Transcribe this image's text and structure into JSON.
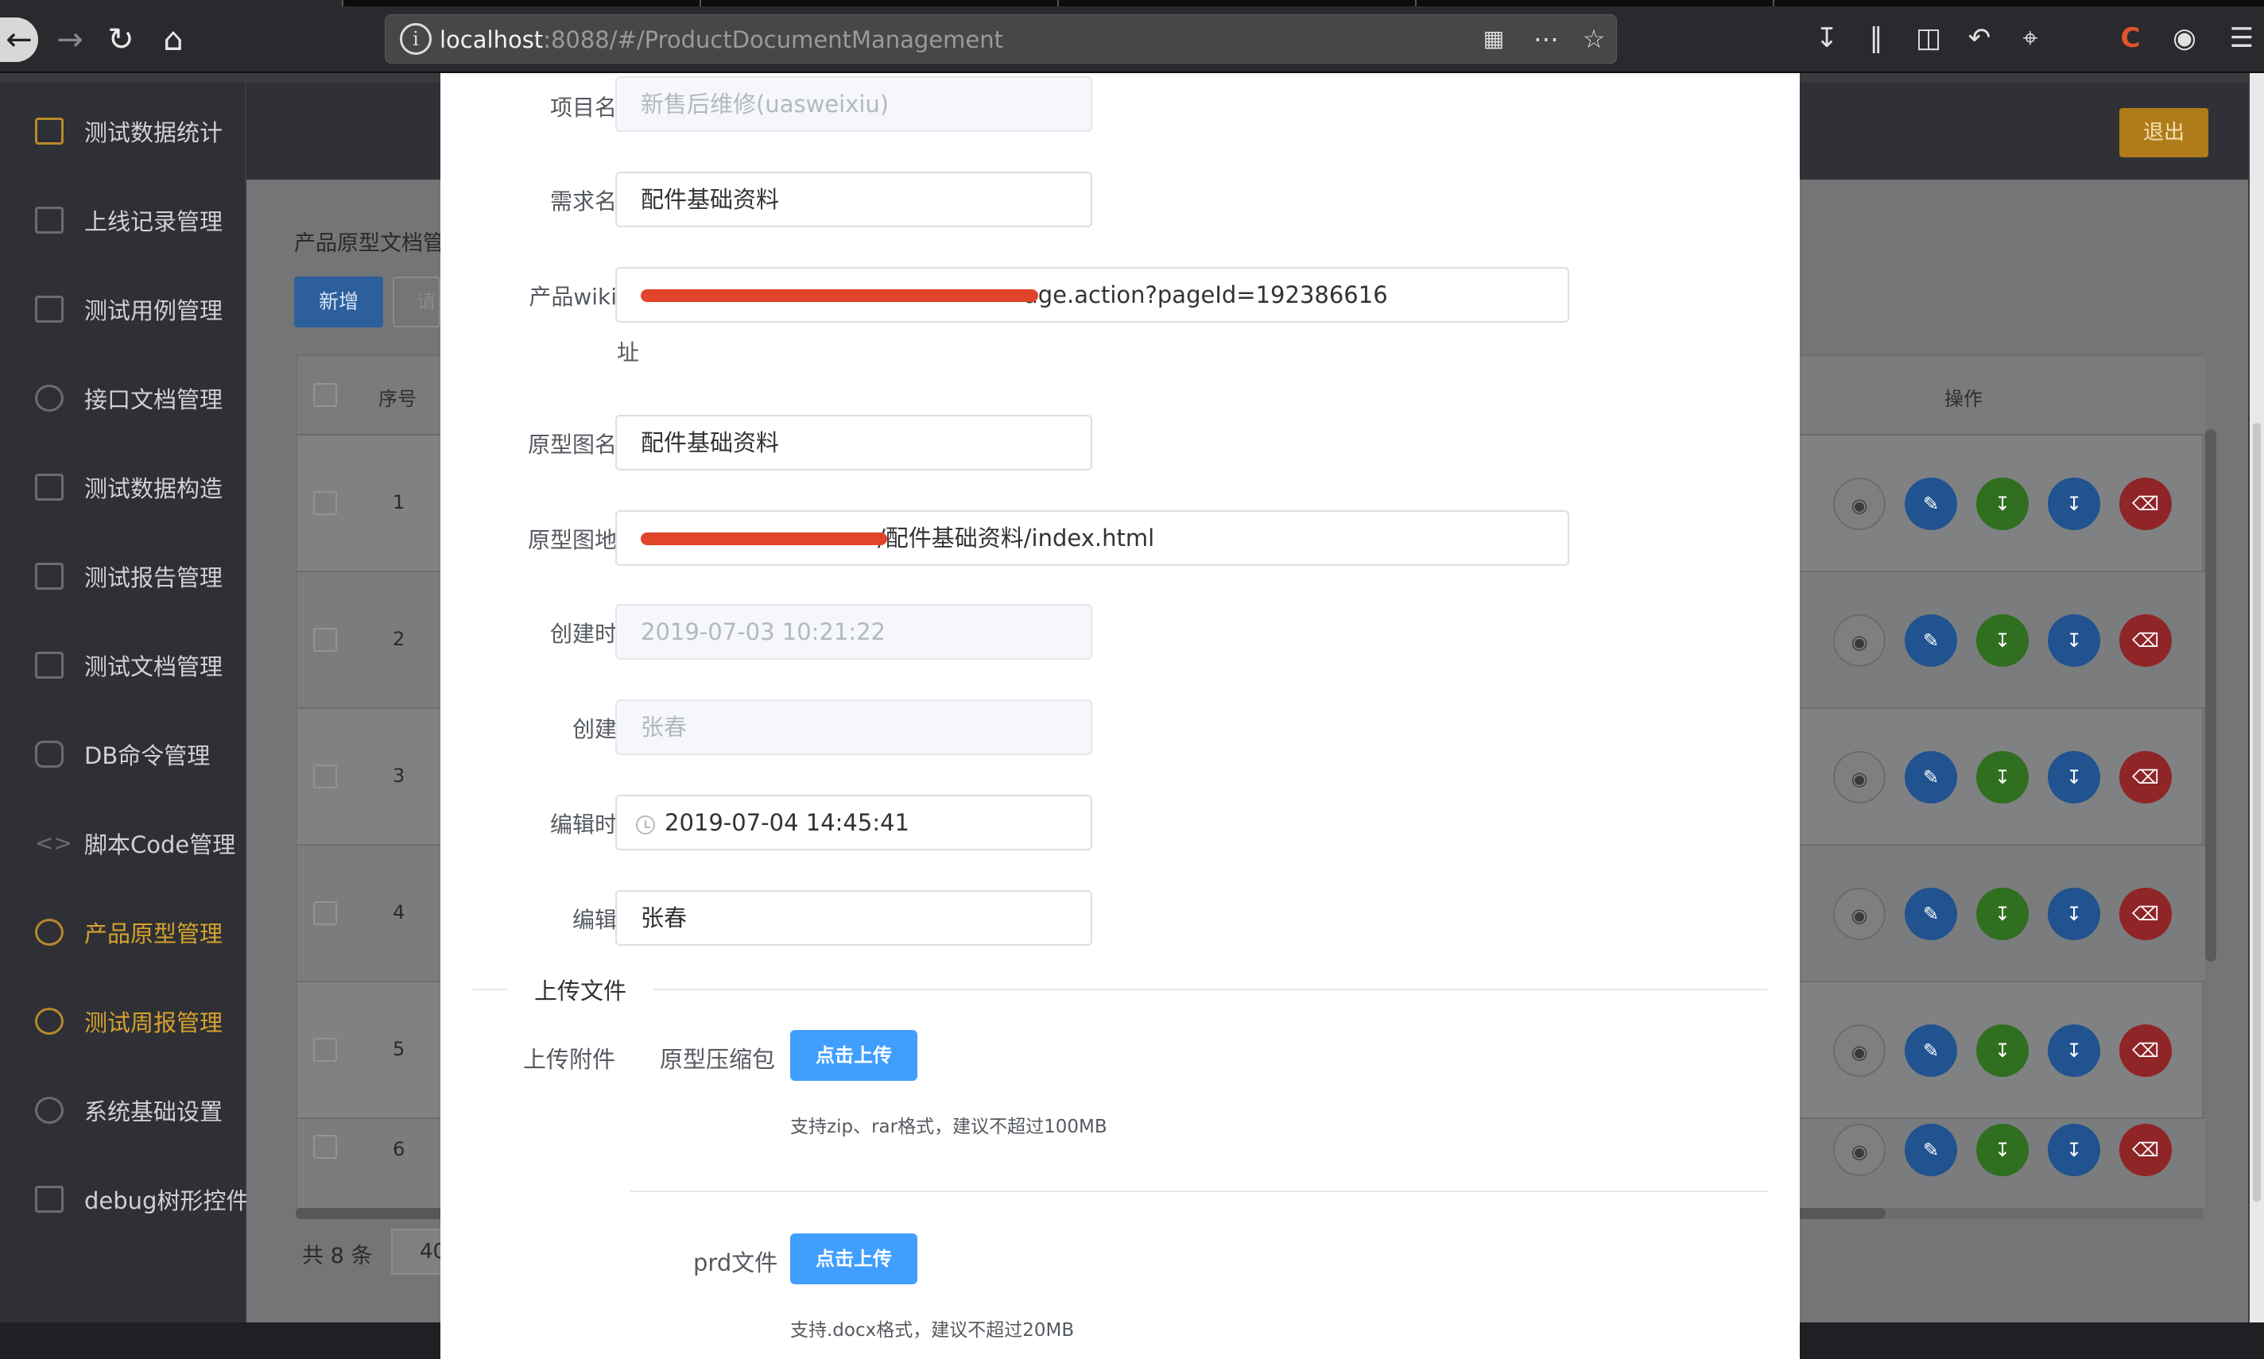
{
  "browser": {
    "url_host": "localhost",
    "url_rest": ":8088/#/ProductDocumentManagement"
  },
  "sidebar": {
    "items": [
      {
        "label": "测试数据统计"
      },
      {
        "label": "上线记录管理"
      },
      {
        "label": "测试用例管理"
      },
      {
        "label": "接口文档管理"
      },
      {
        "label": "测试数据构造"
      },
      {
        "label": "测试报告管理"
      },
      {
        "label": "测试文档管理"
      },
      {
        "label": "DB命令管理"
      },
      {
        "label": "脚本Code管理"
      },
      {
        "label": "产品原型管理"
      },
      {
        "label": "测试周报管理"
      },
      {
        "label": "系统基础设置"
      },
      {
        "label": "debug树形控件"
      }
    ],
    "active_color": "#d6a12e"
  },
  "header": {
    "logout_label": "退出"
  },
  "page": {
    "title": "产品原型文档管",
    "add_label": "新增",
    "search_placeholder_fragment": "请",
    "table": {
      "col_index": "序号",
      "col_ops": "操作",
      "rows": [
        "1",
        "2",
        "3",
        "4",
        "5",
        "6"
      ]
    },
    "pager_total": "共 8 条",
    "pager_size_fragment": "40"
  },
  "modal": {
    "fields": {
      "project_name": {
        "label": "项目名称",
        "value": "新售后维修(uasweixiu)"
      },
      "requirement_name": {
        "label": "需求名称",
        "value": "配件基础资料"
      },
      "wiki_url": {
        "label_line1": "产品wiki地",
        "label_line2": "址",
        "value": "age.action?pageId=192386616"
      },
      "prototype_name": {
        "label": "原型图名称",
        "value": "配件基础资料"
      },
      "prototype_url": {
        "label": "原型图地址",
        "value": "/配件基础资料/index.html"
      },
      "created_time": {
        "label": "创建时间",
        "value": "2019-07-03 10:21:22"
      },
      "creator": {
        "label": "创建者",
        "value": "张春"
      },
      "edited_time": {
        "label": "编辑时间",
        "value": "2019-07-04 14:45:41"
      },
      "editor": {
        "label": "编辑者",
        "value": "张春"
      }
    },
    "upload": {
      "section_title": "上传文件",
      "attachment_label": "上传附件",
      "zip_label": "原型压缩包",
      "zip_button": "点击上传",
      "zip_tip": "支持zip、rar格式，建议不超过100MB",
      "prd_label": "prd文件",
      "prd_button": "点击上传",
      "prd_tip": "支持.docx格式，建议不超过20MB"
    }
  },
  "colors": {
    "primary": "#409eff",
    "disabled_bg": "#f5f7fa",
    "logout": "#b07c19",
    "redaction": "#e2432b"
  }
}
